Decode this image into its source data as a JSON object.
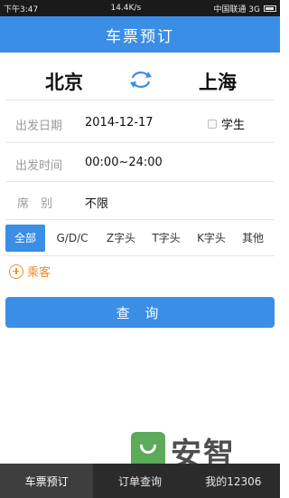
{
  "status": {
    "time": "下午3:47",
    "speed": "14.4K/s",
    "carrier": "中国联通 3G"
  },
  "header": {
    "title": "车票预订"
  },
  "route": {
    "from": "北京",
    "to": "上海",
    "swap_icon": "swap-arrows-icon"
  },
  "form": {
    "date_label": "出发日期",
    "date_value": "2014-12-17",
    "student_label": "学生",
    "time_label": "出发时间",
    "time_value": "00:00~24:00",
    "seat_label": "席　别",
    "seat_value": "不限"
  },
  "train_types": [
    {
      "label": "全部",
      "active": true
    },
    {
      "label": "G/D/C",
      "active": false
    },
    {
      "label": "Z字头",
      "active": false
    },
    {
      "label": "T字头",
      "active": false
    },
    {
      "label": "K字头",
      "active": false
    },
    {
      "label": "其他",
      "active": false
    }
  ],
  "passenger": {
    "label": "乘客",
    "icon": "plus-circle-icon"
  },
  "query_button": "查 询",
  "watermark": {
    "text": "安智",
    "icon": "anzhi-logo-icon"
  },
  "bottom_nav": [
    {
      "label": "车票预订",
      "active": true
    },
    {
      "label": "订单查询",
      "active": false
    },
    {
      "label": "我的12306",
      "active": false
    }
  ],
  "colors": {
    "accent": "#3a8ee6",
    "passenger_orange": "#f08c2a",
    "nav_bg": "#2b2b2b"
  }
}
